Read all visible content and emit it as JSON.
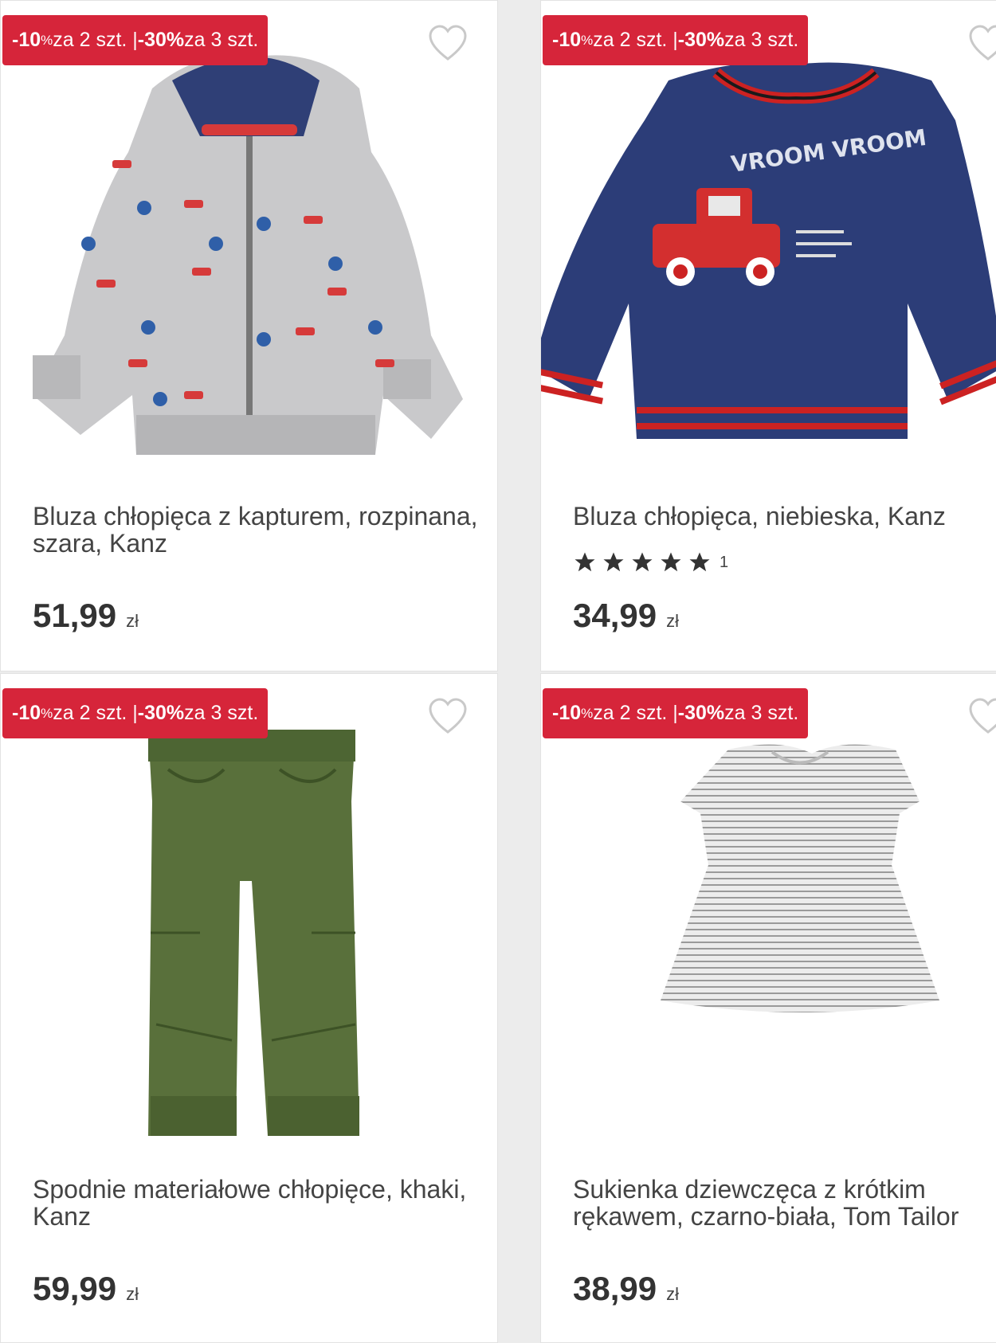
{
  "products": [
    {
      "badge": {
        "p1": "-10",
        "p1pct": "%",
        "p1rest": " za 2 szt. | ",
        "p2": "-30%",
        "p2rest": " za 3 szt."
      },
      "title": "Bluza chłopięca z kapturem, rozpinana, szara, Kanz",
      "price": "51,99",
      "currency": "zł",
      "image": "grey-zip-hoodie-with-car-print"
    },
    {
      "badge": {
        "p1": "-10",
        "p1pct": "%",
        "p1rest": " za 2 szt. | ",
        "p2": "-30%",
        "p2rest": " za 3 szt."
      },
      "title": "Bluza chłopięca, niebieska, Kanz",
      "rating": {
        "stars": 5,
        "count": "1"
      },
      "price": "34,99",
      "currency": "zł",
      "image": "navy-sweatshirt-red-truck",
      "print_text": "VROOM VROOM"
    },
    {
      "badge": {
        "p1": "-10",
        "p1pct": "%",
        "p1rest": " za 2 szt. | ",
        "p2": "-30%",
        "p2rest": " za 3 szt."
      },
      "title": "Spodnie materiałowe chłopięce, khaki, Kanz",
      "price": "59,99",
      "currency": "zł",
      "image": "khaki-jogger-pants"
    },
    {
      "badge": {
        "p1": "-10",
        "p1pct": "%",
        "p1rest": " za 2 szt. | ",
        "p2": "-30%",
        "p2rest": " za 3 szt."
      },
      "title": "Sukienka dziewczęca z krótkim rękawem, czarno-biała, Tom Tailor",
      "price": "38,99",
      "currency": "zł",
      "image": "striped-short-sleeve-dress"
    }
  ],
  "colors": {
    "badge": "#d6253a",
    "text": "#333333",
    "star": "#333333"
  },
  "icons": {
    "favorite": "heart-outline-icon",
    "rating": "star-icon"
  }
}
